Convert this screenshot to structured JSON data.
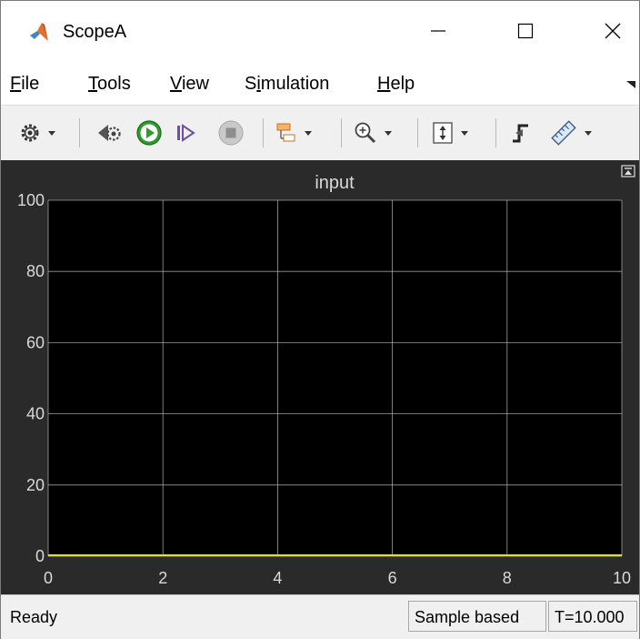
{
  "window": {
    "title": "ScopeA",
    "minimize_glyph": "—",
    "close_glyph": "✕"
  },
  "menu": [
    {
      "label": "File",
      "mnemonic": "F",
      "rest": "ile"
    },
    {
      "label": "Tools",
      "mnemonic": "T",
      "rest": "ools"
    },
    {
      "label": "View",
      "mnemonic": "V",
      "rest": "iew"
    },
    {
      "label": "Simulation",
      "pre": "S",
      "mnemonic": "i",
      "rest": "mulation"
    },
    {
      "label": "Help",
      "mnemonic": "H",
      "rest": "elp"
    }
  ],
  "toolbar": {
    "icons": [
      "settings-icon",
      "step-back-icon",
      "run-icon",
      "step-forward-icon",
      "stop-icon",
      "signal-selector-icon",
      "zoom-in-icon",
      "fit-axes-icon",
      "trigger-icon",
      "measurements-icon"
    ]
  },
  "colors": {
    "plot_bg": "#000000",
    "frame_bg": "#2a2a2a",
    "grid": "#cfcfcf",
    "line": "#e6e600",
    "axis_text": "#d9d9d9",
    "title_text": "#d9d9d9"
  },
  "chart_data": {
    "type": "line",
    "title": "input",
    "xlabel": "",
    "ylabel": "",
    "xlim": [
      0,
      10
    ],
    "ylim": [
      0,
      100
    ],
    "x_ticks": [
      0,
      2,
      4,
      6,
      8,
      10
    ],
    "y_ticks": [
      0,
      20,
      40,
      60,
      80,
      100
    ],
    "grid": true,
    "series": [
      {
        "color": "#e6e600",
        "x": [
          0,
          10
        ],
        "y": [
          0,
          0
        ]
      }
    ]
  },
  "status": {
    "ready": "Ready",
    "mode": "Sample based",
    "time": "T=10.000"
  }
}
